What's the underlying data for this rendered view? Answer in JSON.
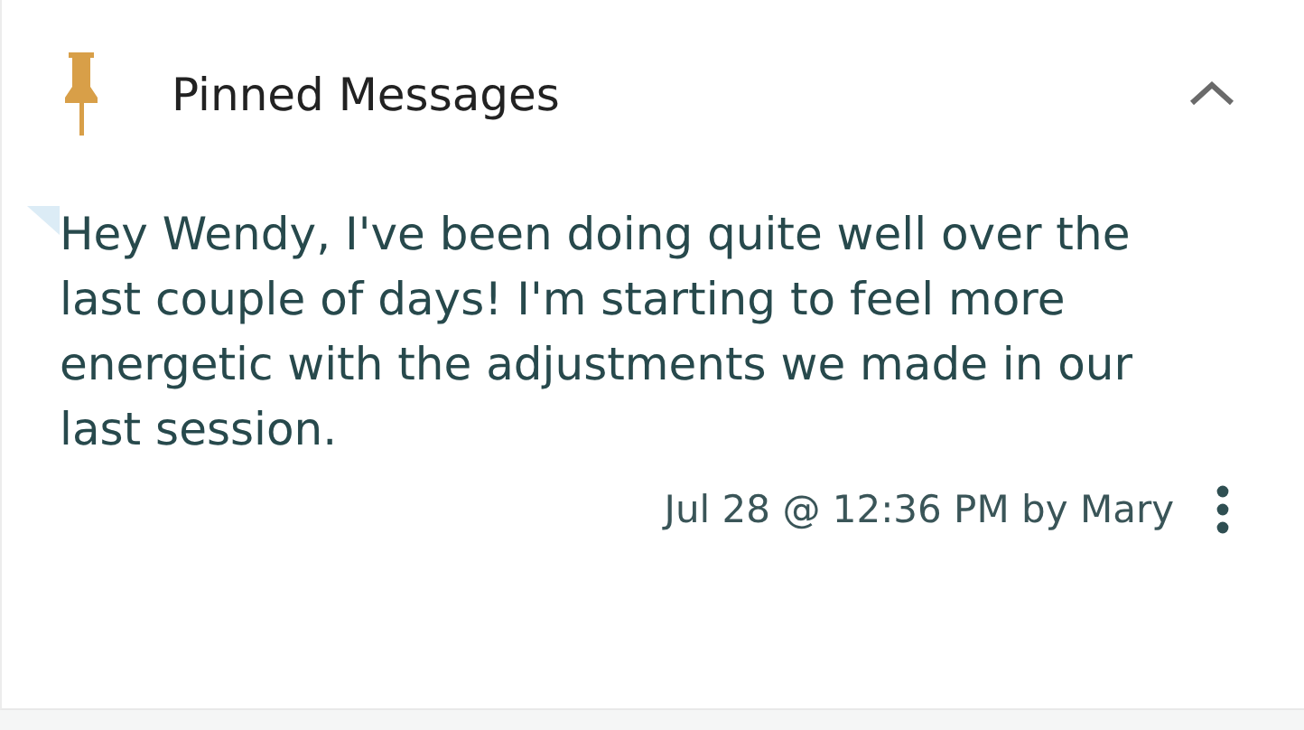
{
  "panel": {
    "title": "Pinned Messages",
    "expanded": true
  },
  "messages": [
    {
      "text": "Hey Wendy, I've been doing quite well over the last couple of days! I'm starting to feel more energetic with the adjustments we made in our last session.",
      "meta": "Jul 28 @ 12:36 PM by Mary"
    }
  ]
}
